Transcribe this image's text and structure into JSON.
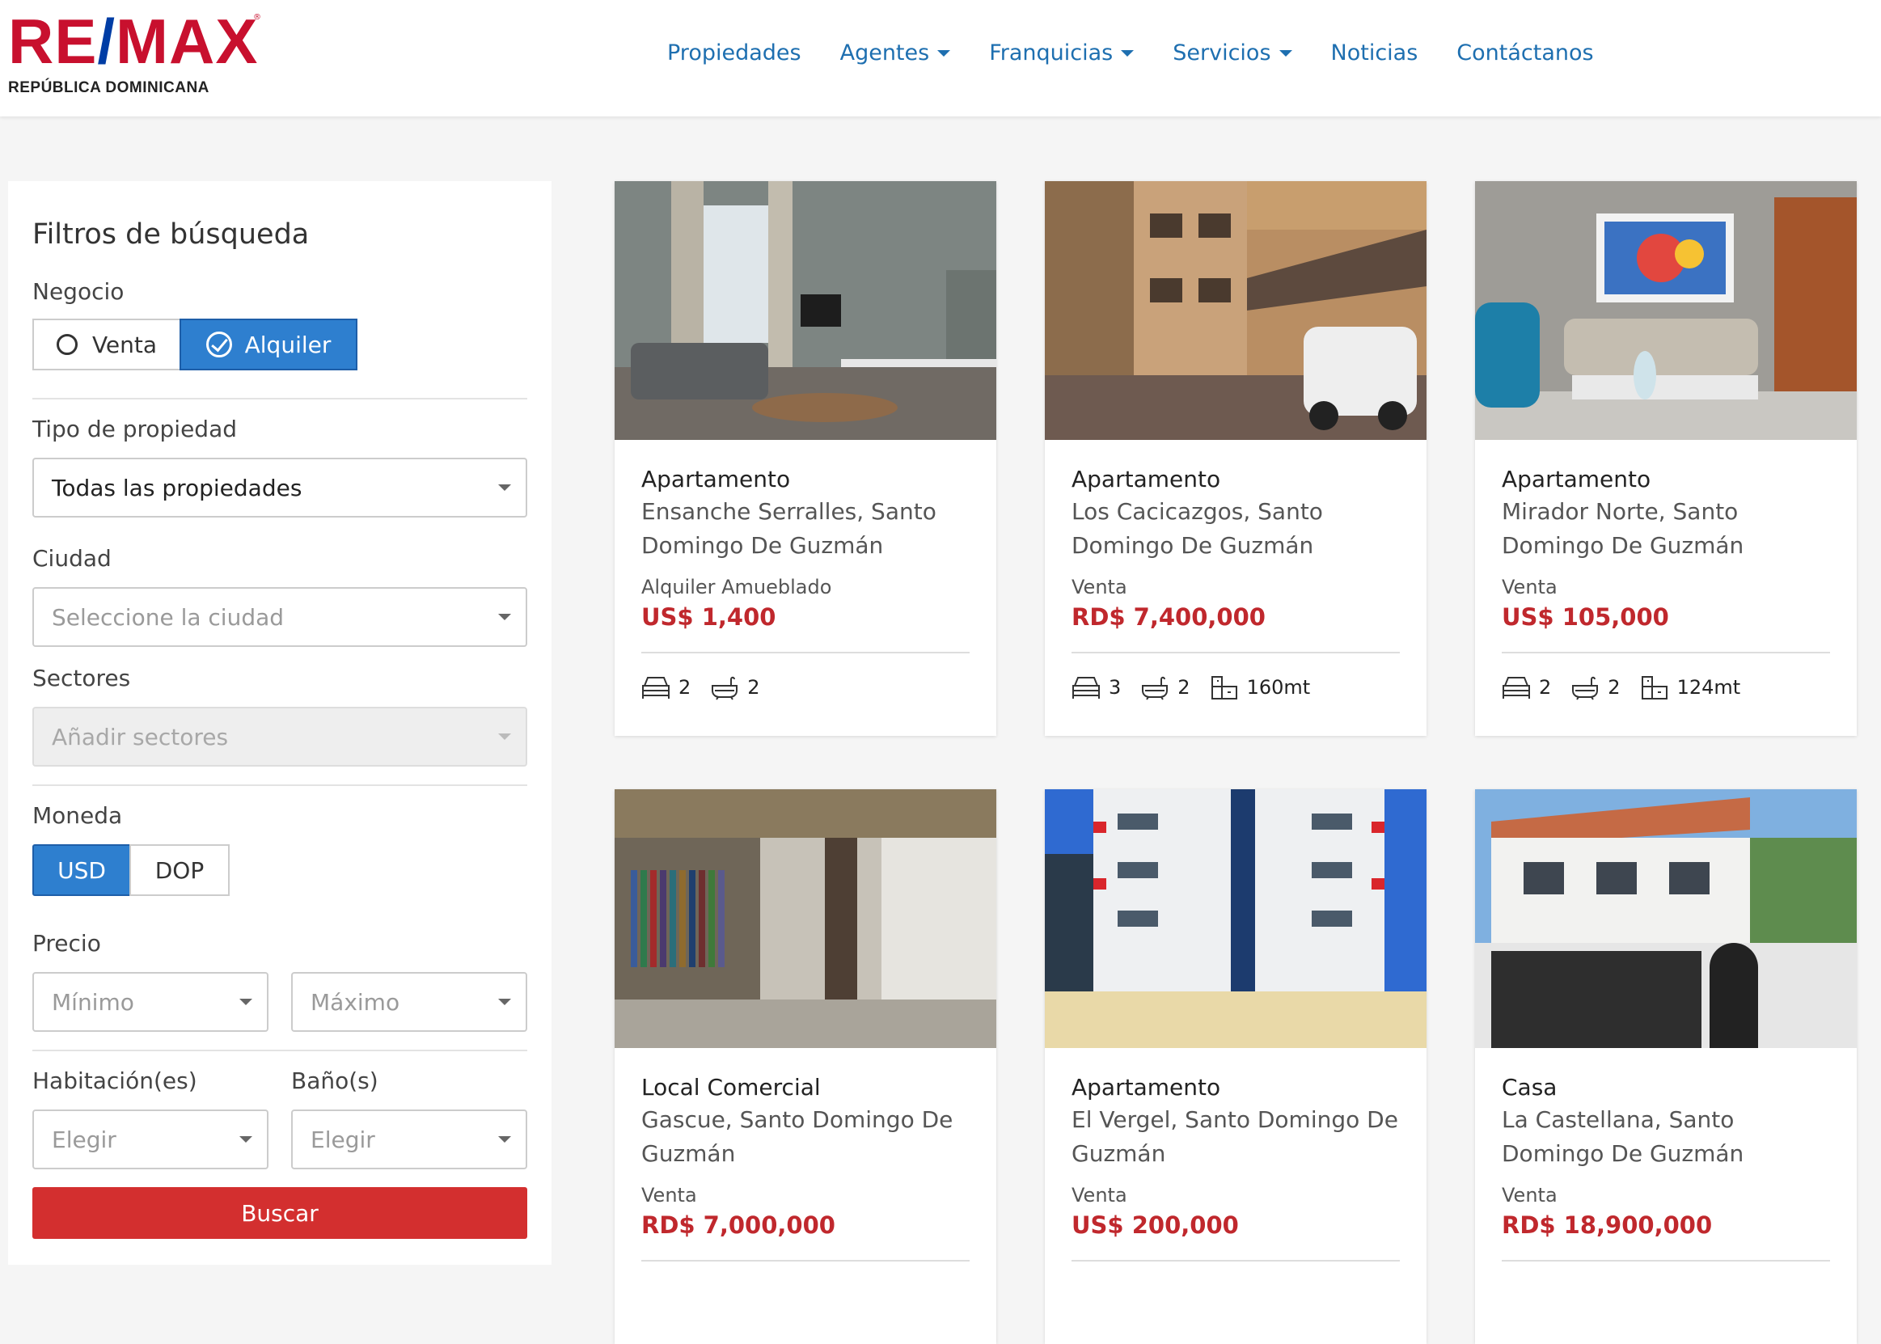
{
  "brand": {
    "name_re": "RE",
    "name_slash": "/",
    "name_max": "MAX",
    "reg": "®",
    "subtitle": "REPÚBLICA DOMINICANA",
    "red": "#c8102e",
    "blue": "#003da5"
  },
  "nav": [
    {
      "label": "Propiedades",
      "dropdown": false
    },
    {
      "label": "Agentes",
      "dropdown": true
    },
    {
      "label": "Franquicias",
      "dropdown": true
    },
    {
      "label": "Servicios",
      "dropdown": true
    },
    {
      "label": "Noticias",
      "dropdown": false
    },
    {
      "label": "Contáctanos",
      "dropdown": false
    }
  ],
  "filters": {
    "title": "Filtros de búsqueda",
    "negocio_label": "Negocio",
    "venta_label": "Venta",
    "alquiler_label": "Alquiler",
    "tipo_label": "Tipo de propiedad",
    "tipo_value": "Todas las propiedades",
    "ciudad_label": "Ciudad",
    "ciudad_placeholder": "Seleccione la ciudad",
    "sectores_label": "Sectores",
    "sectores_placeholder": "Añadir sectores",
    "moneda_label": "Moneda",
    "usd_label": "USD",
    "dop_label": "DOP",
    "precio_label": "Precio",
    "min_placeholder": "Mínimo",
    "max_placeholder": "Máximo",
    "hab_label": "Habitación(es)",
    "banos_label": "Baño(s)",
    "hab_placeholder": "Elegir",
    "banos_placeholder": "Elegir",
    "search_label": "Buscar",
    "accent": "#2e7fcf",
    "button_color": "#d32f2f"
  },
  "listings": [
    {
      "type": "Apartamento",
      "location": "Ensanche Serralles, Santo Domingo De Guzmán",
      "business": "Alquiler Amueblado",
      "price": "US$ 1,400",
      "beds": "2",
      "baths": "2",
      "area": ""
    },
    {
      "type": "Apartamento",
      "location": "Los Cacicazgos, Santo Domingo De Guzmán",
      "business": "Venta",
      "price": "RD$ 7,400,000",
      "beds": "3",
      "baths": "2",
      "area": "160mt"
    },
    {
      "type": "Apartamento",
      "location": "Mirador Norte, Santo Domingo De Guzmán",
      "business": "Venta",
      "price": "US$ 105,000",
      "beds": "2",
      "baths": "2",
      "area": "124mt"
    },
    {
      "type": "Local Comercial",
      "location": "Gascue, Santo Domingo De Guzmán",
      "business": "Venta",
      "price": "RD$ 7,000,000",
      "beds": "",
      "baths": "",
      "area": ""
    },
    {
      "type": "Apartamento",
      "location": "El Vergel, Santo Domingo De Guzmán",
      "business": "Venta",
      "price": "US$ 200,000",
      "beds": "",
      "baths": "",
      "area": ""
    },
    {
      "type": "Casa",
      "location": "La Castellana, Santo Domingo De Guzmán",
      "business": "Venta",
      "price": "RD$ 18,900,000",
      "beds": "",
      "baths": "",
      "area": ""
    }
  ]
}
